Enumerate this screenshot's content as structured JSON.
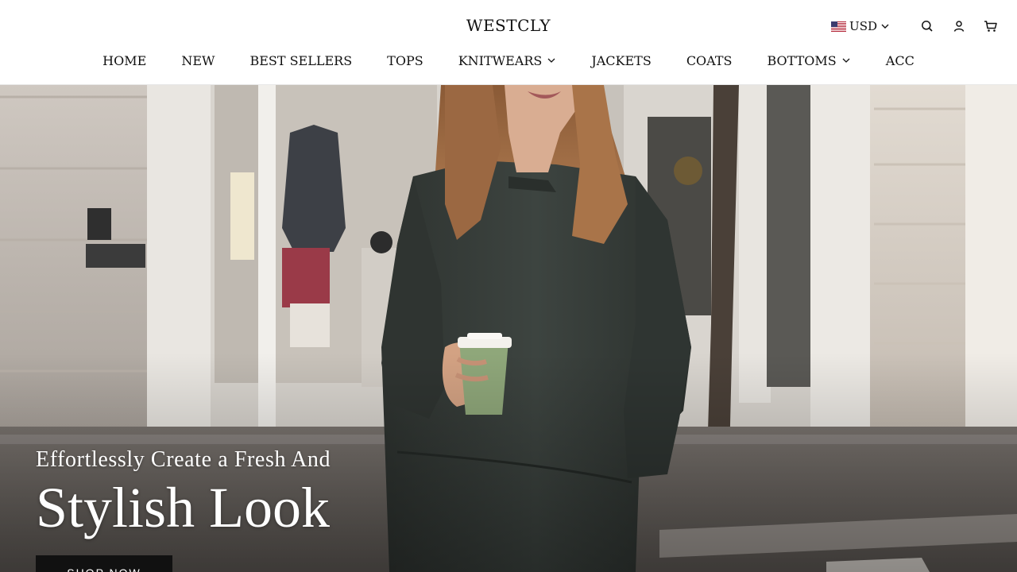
{
  "brand": {
    "logo": "WESTCLY"
  },
  "utilities": {
    "currency": "USD",
    "icons": [
      "search-icon",
      "account-icon",
      "cart-icon"
    ]
  },
  "nav": {
    "items": [
      {
        "label": "HOME",
        "dropdown": false
      },
      {
        "label": "NEW",
        "dropdown": false
      },
      {
        "label": "BEST SELLERS",
        "dropdown": false
      },
      {
        "label": "TOPS",
        "dropdown": false
      },
      {
        "label": "KNITWEARS",
        "dropdown": true
      },
      {
        "label": "JACKETS",
        "dropdown": false
      },
      {
        "label": "COATS",
        "dropdown": false
      },
      {
        "label": "BOTTOMS",
        "dropdown": true
      },
      {
        "label": "ACC",
        "dropdown": false
      }
    ]
  },
  "hero": {
    "subtitle": "Effortlessly Create a Fresh And",
    "title": "Stylish Look",
    "cta": "SHOP NOW"
  },
  "colors": {
    "header_bg": "#ffffff",
    "text": "#111111",
    "cta_bg": "#111111",
    "cta_text": "#ffffff"
  }
}
